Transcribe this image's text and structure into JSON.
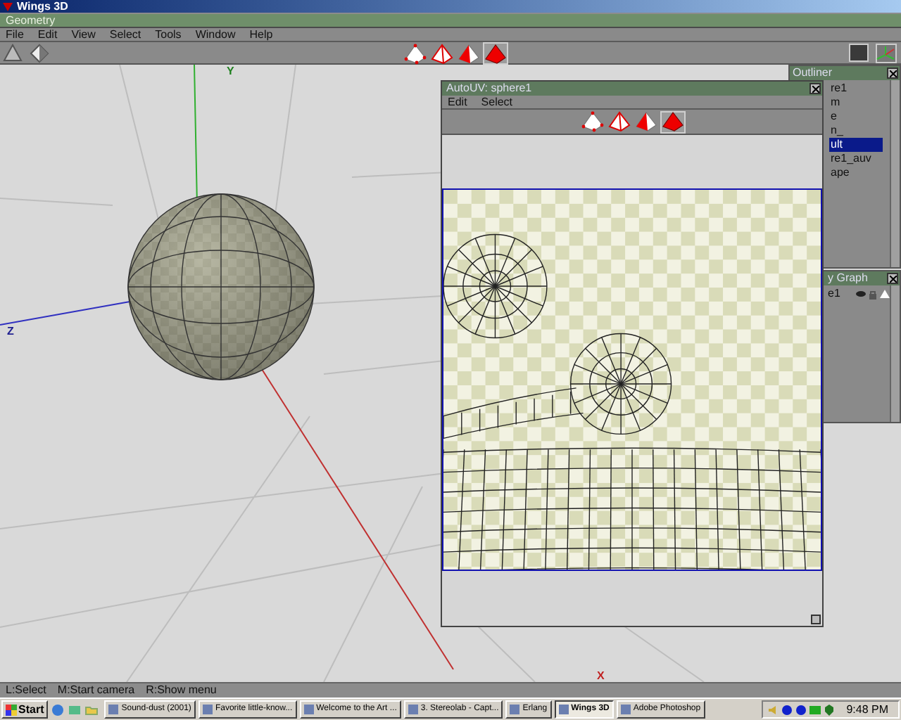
{
  "window": {
    "title": "Wings 3D"
  },
  "geometry_bar": {
    "title": "Geometry"
  },
  "menu": [
    "File",
    "Edit",
    "View",
    "Select",
    "Tools",
    "Window",
    "Help"
  ],
  "toolbar": {
    "select_modes": [
      {
        "kind": "vertex",
        "selected": false
      },
      {
        "kind": "edge",
        "selected": false
      },
      {
        "kind": "face",
        "selected": false
      },
      {
        "kind": "body",
        "selected": true
      }
    ]
  },
  "viewport": {
    "axis_labels": [
      {
        "kind": "y",
        "text": "Y"
      },
      {
        "kind": "z",
        "text": "Z"
      },
      {
        "kind": "x",
        "text": "X"
      }
    ]
  },
  "autouv": {
    "title": "AutoUV: sphere1",
    "menu": [
      "Edit",
      "Select"
    ],
    "select_modes": [
      {
        "kind": "vertex",
        "selected": false
      },
      {
        "kind": "edge",
        "selected": false
      },
      {
        "kind": "face",
        "selected": false
      },
      {
        "kind": "body",
        "selected": true
      }
    ]
  },
  "outliner": {
    "title": "Outliner",
    "items": [
      {
        "label": "re1",
        "selected": false
      },
      {
        "label": "m",
        "selected": false
      },
      {
        "label": "e",
        "selected": false
      },
      {
        "label": "n_",
        "selected": false
      },
      {
        "label": "ult",
        "selected": true
      },
      {
        "label": "re1_auv",
        "selected": false
      },
      {
        "label": "ape",
        "selected": false
      }
    ]
  },
  "geometry_graph": {
    "title": "y Graph",
    "items": [
      {
        "label": "e1"
      }
    ]
  },
  "status_bar": [
    "L:Select",
    "M:Start camera",
    "R:Show menu"
  ],
  "taskbar": {
    "start": "Start",
    "tasks": [
      {
        "label": "Sound-dust (2001)",
        "selected": false
      },
      {
        "label": "Favorite little-know...",
        "selected": false
      },
      {
        "label": "Welcome to the Art ...",
        "selected": false
      },
      {
        "label": "3. Stereolab - Capt...",
        "selected": false
      },
      {
        "label": "Erlang",
        "selected": false
      },
      {
        "label": "Wings 3D",
        "selected": true
      },
      {
        "label": "Adobe Photoshop",
        "selected": false
      }
    ],
    "clock": "9:48 PM"
  }
}
